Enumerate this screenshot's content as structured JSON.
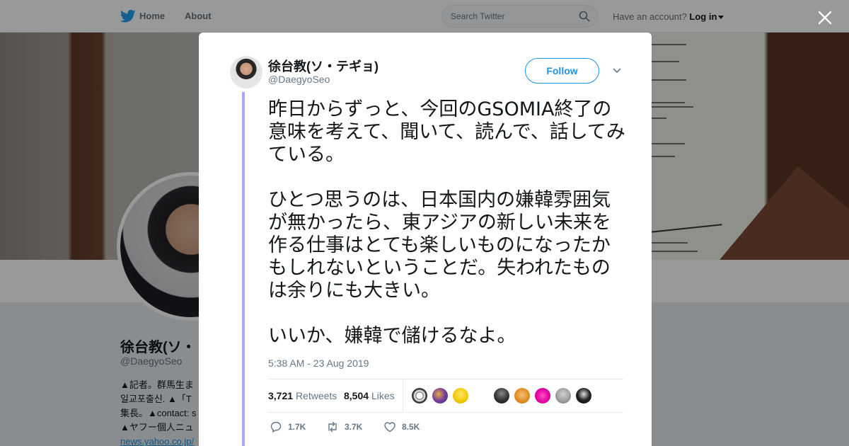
{
  "nav": {
    "home_label": "Home",
    "about_label": "About",
    "search_placeholder": "Search Twitter",
    "account_prompt": "Have an account?",
    "login_label": "Log in"
  },
  "profile_background": {
    "name": "徐台教(ソ・",
    "handle": "@DaegyoSeo",
    "bio_lines": [
      "▲記者。群馬生ま",
      "일교포출신. ▲「T",
      "集長。▲contact: s",
      "▲ヤフー個人ニュ"
    ],
    "bio_link": "news.yahoo.co.jp/"
  },
  "tweet": {
    "author_name": "徐台教(ソ・テギョ)",
    "author_handle": "@DaegyoSeo",
    "follow_label": "Follow",
    "paragraphs": [
      "昨日からずっと、今回のGSOMIA終了の意味を考えて、聞いて、読んで、話してみている。",
      "ひとつ思うのは、日本国内の嫌韓雰囲気が無かったら、東アジアの新しい未来を作る仕事はとても楽しいものになったかもしれないということだ。失われたものは余りにも大きい。",
      "いいか、嫌韓で儲けるなよ。"
    ],
    "timestamp": "5:38 AM - 23 Aug 2019",
    "retweets_count": "3,721",
    "retweets_label": "Retweets",
    "likes_count": "8,504",
    "likes_label": "Likes",
    "replies_short": "1.7K",
    "retweets_short": "3.7K",
    "likes_short": "8.5K"
  },
  "icons": {
    "logo": "twitter-bird-icon",
    "search": "search-icon",
    "close": "close-icon",
    "more": "chevron-down-icon",
    "reply": "reply-icon",
    "retweet": "retweet-icon",
    "like": "heart-icon"
  },
  "colors": {
    "brand": "#1b95e0",
    "thread_line": "#a8a6f2",
    "overlay": "rgba(0,0,0,0.4)",
    "muted_text": "#657786"
  }
}
